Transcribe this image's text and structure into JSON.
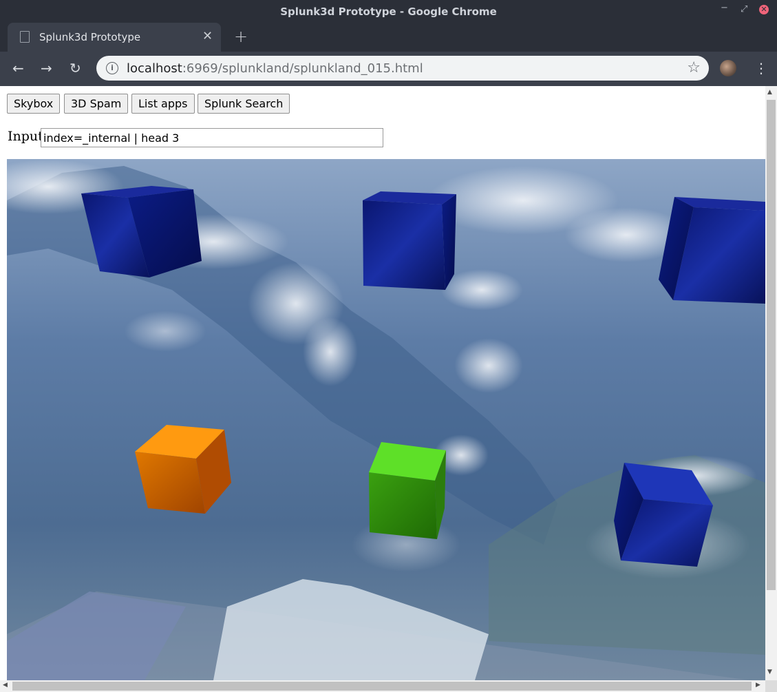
{
  "window": {
    "title": "Splunk3d Prototype - Google Chrome",
    "controls": [
      "minimize-icon",
      "maximize-icon",
      "close-icon"
    ]
  },
  "tabs": [
    {
      "label": "Splunk3d Prototype",
      "icon": "page-icon",
      "active": true
    }
  ],
  "toolbar": {
    "url_host": "localhost",
    "url_rest": ":6969/splunkland/splunkland_015.html",
    "icons": [
      "back-icon",
      "forward-icon",
      "reload-icon",
      "info-icon",
      "bookmark-star-icon",
      "profile-avatar",
      "menu-icon"
    ]
  },
  "page": {
    "buttons": [
      "Skybox",
      "3D Spam",
      "List apps",
      "Splunk Search"
    ],
    "input_label": "Input",
    "input_value": "index=_internal | head 3"
  },
  "scene": {
    "background": "mountain skybox",
    "cubes": [
      {
        "color": "#0a1a8a",
        "label": "blue cube"
      },
      {
        "color": "#0a1a8a",
        "label": "blue cube"
      },
      {
        "color": "#0a1a8a",
        "label": "blue cube"
      },
      {
        "color": "#f08a00",
        "label": "orange cube"
      },
      {
        "color": "#4bd11e",
        "label": "green cube"
      },
      {
        "color": "#0a1a8a",
        "label": "blue cube"
      }
    ]
  },
  "colors": {
    "chrome_dark": "#2b2f38",
    "chrome_toolbar": "#3b404b",
    "omnibox": "#f1f3f4"
  }
}
